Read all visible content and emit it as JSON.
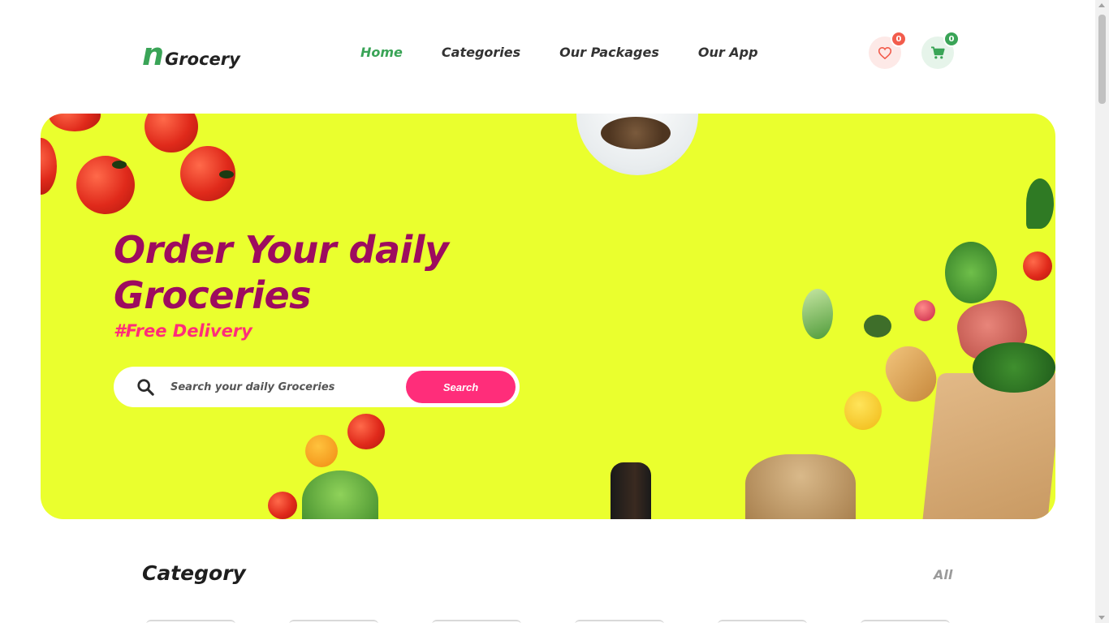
{
  "brand": {
    "mark": "n",
    "name": "Grocery"
  },
  "nav": {
    "items": [
      {
        "label": "Home",
        "active": true
      },
      {
        "label": "Categories",
        "active": false
      },
      {
        "label": "Our Packages",
        "active": false
      },
      {
        "label": "Our App",
        "active": false
      }
    ]
  },
  "header_actions": {
    "wishlist": {
      "icon": "heart-icon",
      "count": "0"
    },
    "cart": {
      "icon": "shopping-cart-icon",
      "count": "0"
    }
  },
  "hero": {
    "title_line1": "Order Your daily",
    "title_line2": "Groceries",
    "subtitle": "#Free Delivery",
    "search": {
      "placeholder": "Search your daily Groceries",
      "value": "",
      "button_label": "Search"
    }
  },
  "category": {
    "title": "Category",
    "all_label": "All"
  },
  "colors": {
    "brand_green": "#3aa457",
    "hero_bg": "#eaff2e",
    "hero_title": "#9d0b5f",
    "accent_pink": "#ff2d7a",
    "wishlist_red": "#f25c4c"
  }
}
